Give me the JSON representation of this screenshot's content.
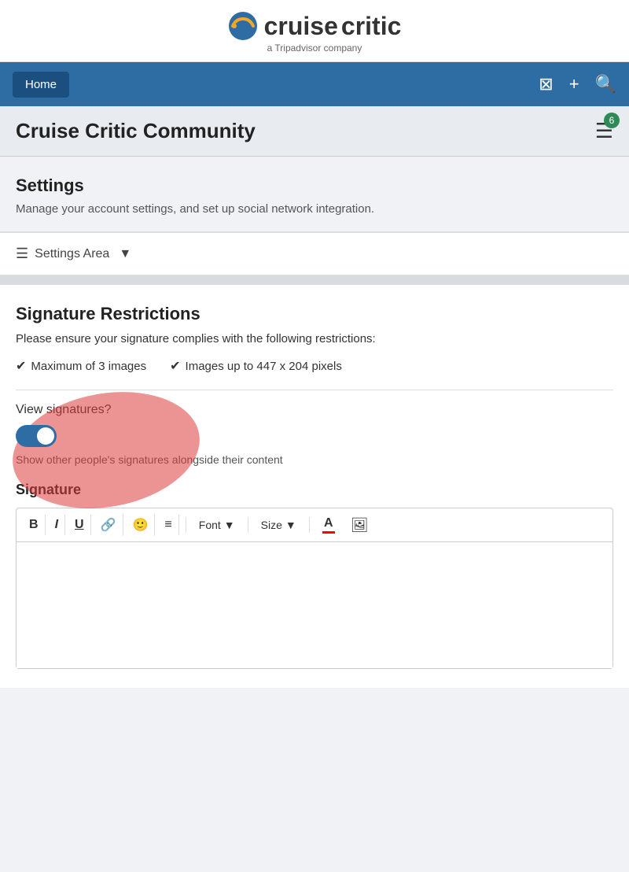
{
  "site": {
    "logo_main": "cruisecritic",
    "logo_sub": "a Tripadvisor company",
    "logo_part1": "cruise",
    "logo_part2": "critic"
  },
  "nav": {
    "home_label": "Home",
    "badge_count": "6"
  },
  "community": {
    "title": "Cruise Critic Community"
  },
  "settings": {
    "title": "Settings",
    "description": "Manage your account settings, and set up social network integration.",
    "area_label": "Settings Area"
  },
  "signature_restrictions": {
    "title": "Signature Restrictions",
    "description": "Please ensure your signature complies with the following restrictions:",
    "restriction1": "Maximum of 3 images",
    "restriction2": "Images up to 447 x 204 pixels"
  },
  "view_signatures": {
    "label": "View signatures?",
    "help_text": "Show other people's signatures alongside their content",
    "enabled": true
  },
  "signature_editor": {
    "label": "Signature",
    "toolbar": {
      "bold": "B",
      "italic": "I",
      "underline": "U",
      "font_label": "Font",
      "size_label": "Size"
    }
  }
}
